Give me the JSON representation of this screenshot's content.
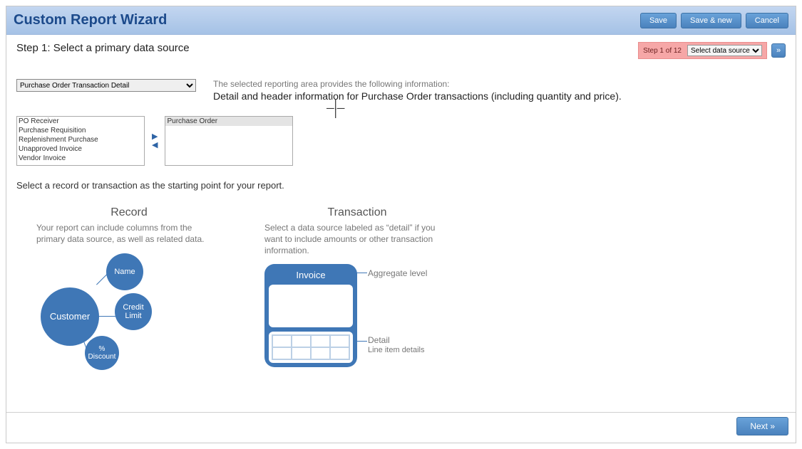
{
  "header": {
    "title": "Custom Report Wizard",
    "save": "Save",
    "save_new": "Save & new",
    "cancel": "Cancel"
  },
  "step": {
    "title": "Step 1: Select a primary data source",
    "badge_text": "Step 1 of 12",
    "badge_select": "Select data source"
  },
  "source_select": "Purchase Order Transaction Detail",
  "intro_label": "The selected reporting area provides the following information:",
  "intro_main": "Detail and header information for Purchase Order transactions (including quantity and price).",
  "left_list": [
    "PO Receiver",
    "Purchase Requisition",
    "Replenishment Purchase",
    "Unapproved Invoice",
    "Vendor Invoice"
  ],
  "right_list": [
    "Purchase Order"
  ],
  "hint": "Select a record or transaction as the starting point for your report.",
  "record": {
    "heading": "Record",
    "desc": "Your report can include columns from the primary data source, as well as related data.",
    "bubbles": {
      "customer": "Customer",
      "name": "Name",
      "credit": "Credit\nLimit",
      "discount": "%\nDiscount"
    }
  },
  "transaction": {
    "heading": "Transaction",
    "desc": "Select a data source labeled as “detail” if you want to include amounts or other transaction information.",
    "card_title": "Invoice",
    "aggregate_label": "Aggregate level",
    "detail_label": "Detail",
    "detail_sub": "Line item details"
  },
  "footer": {
    "next": "Next »"
  }
}
